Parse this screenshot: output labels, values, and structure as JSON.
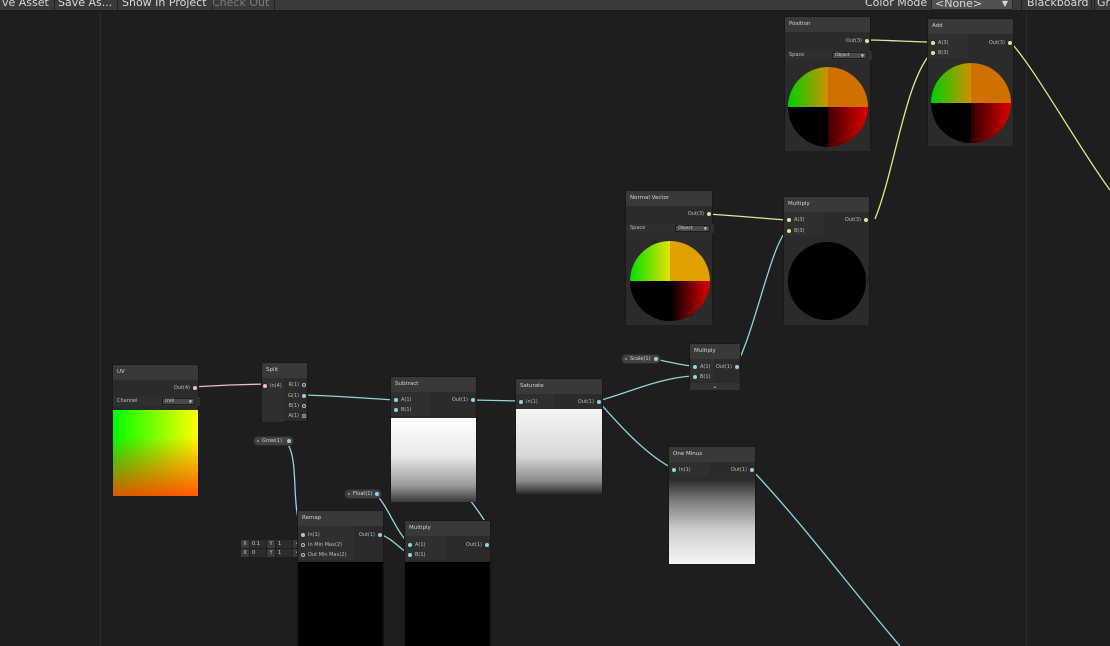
{
  "toolbar": {
    "save_asset": "ve Asset",
    "save_as": "Save As...",
    "show_in_project": "Show In Project",
    "check_out": "Check Out",
    "color_mode_label": "Color Mode",
    "color_mode_value": "<None>",
    "blackboard": "Blackboard",
    "graph_inspector": "Gr"
  },
  "colors": {
    "wire_float": "#8fd6de",
    "wire_vector3": "#e8e38f",
    "wire_vector4": "#f3b8c8",
    "canvas_bg": "#1e1e1e",
    "node_bg": "#2b2b2b"
  },
  "nodes": {
    "uv": {
      "title": "UV",
      "out": "Out(4)",
      "channel_label": "Channel",
      "channel_value": "UV0"
    },
    "split": {
      "title": "Split",
      "in": "In(4)",
      "out_r": "R(1)",
      "out_g": "G(1)",
      "out_b": "B(1)",
      "out_a": "A(1)"
    },
    "subtract": {
      "title": "Subtract",
      "in_a": "A(1)",
      "in_b": "B(1)",
      "out": "Out(1)"
    },
    "saturate": {
      "title": "Saturate",
      "in": "In(1)",
      "out": "Out(1)"
    },
    "multiply_small": {
      "title": "Multiply",
      "in_a": "A(1)",
      "in_b": "B(1)",
      "out": "Out(1)",
      "expand_icon": "chevron-down"
    },
    "one_minus": {
      "title": "One Minus",
      "in": "In(1)",
      "out": "Out(1)"
    },
    "normal_vector": {
      "title": "Normal Vector",
      "out": "Out(3)",
      "space_label": "Space",
      "space_value": "Object"
    },
    "multiply_normal": {
      "title": "Multiply",
      "in_a": "A(3)",
      "in_b": "B(3)",
      "out": "Out(3)"
    },
    "position": {
      "title": "Position",
      "out": "Out(3)",
      "space_label": "Space",
      "space_value": "Object"
    },
    "add": {
      "title": "Add",
      "in_a": "A(3)",
      "in_b": "B(3)",
      "out": "Out(3)"
    },
    "remap": {
      "title": "Remap",
      "in": "In(1)",
      "in_minmax": "In Min Max(2)",
      "out_minmax": "Out Min Max(2)",
      "out": "Out(1)"
    },
    "multiply_bottom": {
      "title": "Multiply",
      "in_a": "A(1)",
      "in_b": "B(1)",
      "out": "Out(1)"
    }
  },
  "properties": {
    "scale": "Scale(1)",
    "grow": "Grow(1)",
    "float": "Float(1)"
  },
  "remap_fields": {
    "in_x_label": "X",
    "in_x_value": "0.1",
    "in_y_label": "Y",
    "in_y_value": "1",
    "out_x_label": "X",
    "out_x_value": "0",
    "out_y_label": "Y",
    "out_y_value": "1"
  }
}
